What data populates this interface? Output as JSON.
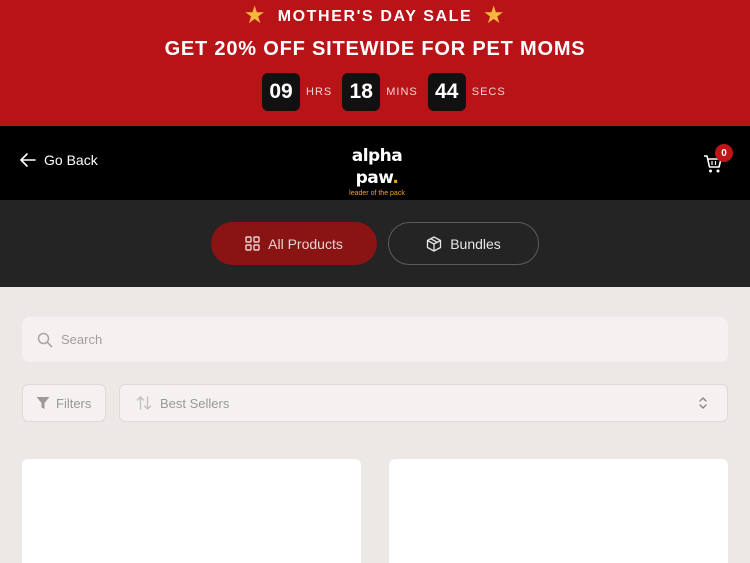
{
  "promo": {
    "title": "MOTHER'S DAY SALE",
    "subtitle": "GET 20% OFF SITEWIDE FOR PET MOMS",
    "countdown": {
      "hours": "09",
      "hours_label": "HRS",
      "minutes": "18",
      "minutes_label": "MINS",
      "seconds": "44",
      "seconds_label": "SECS"
    },
    "colors": {
      "background": "#b81418",
      "star": "#f5b83d"
    }
  },
  "header": {
    "back_label": "Go Back",
    "logo_text": "alpha paw",
    "logo_tagline": "leader of the pack",
    "cart_count": "0",
    "colors": {
      "background": "#000000",
      "accent": "#f4a51c"
    }
  },
  "nav": {
    "tabs": [
      {
        "label": "All Products",
        "icon": "grid-icon",
        "active": true
      },
      {
        "label": "Bundles",
        "icon": "box-icon",
        "active": false
      }
    ],
    "colors": {
      "active": "#8a1313",
      "background": "#242424"
    }
  },
  "search": {
    "placeholder": "Search",
    "value": ""
  },
  "controls": {
    "filters_label": "Filters",
    "sort_selected": "Best Sellers"
  }
}
